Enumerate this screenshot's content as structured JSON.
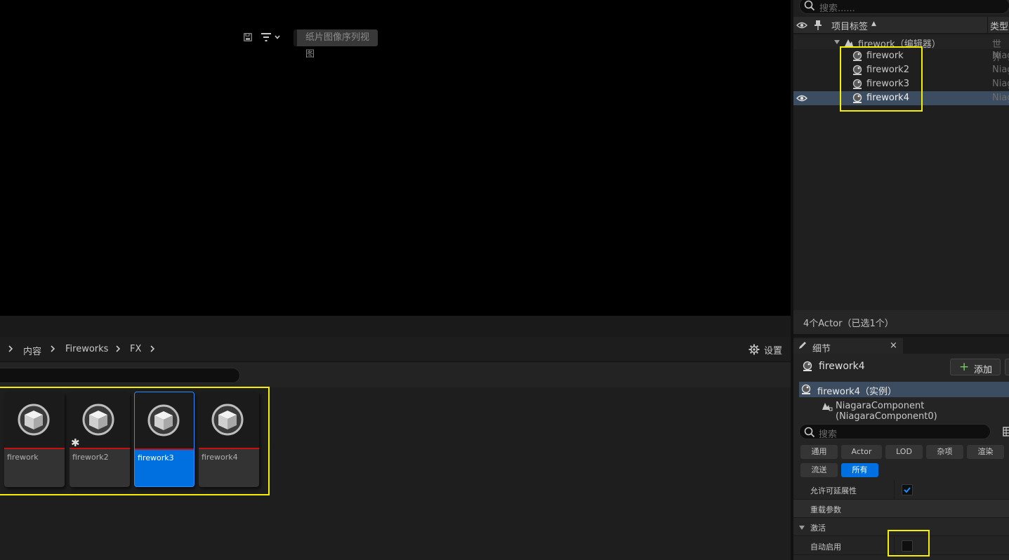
{
  "content_browser": {
    "breadcrumbs": [
      "内容",
      "Fireworks",
      "FX"
    ],
    "settings_label": "设置",
    "sprite_view_label": "纸片图像序列视图",
    "assets": [
      {
        "name": "firework",
        "dirty": false,
        "selected": false
      },
      {
        "name": "firework2",
        "dirty": true,
        "selected": false
      },
      {
        "name": "firework3",
        "dirty": false,
        "selected": true
      },
      {
        "name": "firework4",
        "dirty": false,
        "selected": false
      }
    ]
  },
  "outliner": {
    "search_placeholder": "搜索......",
    "column_label": "项目标签",
    "column_sort": "▲",
    "column_type": "类型",
    "world_label": "firework（编辑器）",
    "world_type": "世界",
    "items": [
      {
        "label": "firework",
        "type": "Niag"
      },
      {
        "label": "firework2",
        "type": "Niag"
      },
      {
        "label": "firework3",
        "type": "Niag"
      },
      {
        "label": "firework4",
        "type": "Niag",
        "selected": true
      }
    ],
    "footer": "4个Actor（已选1个）"
  },
  "details": {
    "tab_title": "细节",
    "tab_close": "×",
    "actor_name": "firework4",
    "add_label": "添加",
    "components": [
      {
        "label": "firework4（实例）",
        "selected": true
      },
      {
        "label": "NiagaraComponent (NiagaraComponent0)",
        "selected": false
      }
    ],
    "search_placeholder": "搜索",
    "filter_chips": [
      "通用",
      "Actor",
      "LOD",
      "杂项",
      "渲染",
      "流送",
      "所有"
    ],
    "active_chip": "所有",
    "properties": [
      {
        "label": "允许可延展性",
        "checked": true
      },
      {
        "label": "重载参数",
        "category": false
      },
      {
        "label": "激活",
        "category": true
      },
      {
        "label": "自动启用",
        "checked": false
      }
    ]
  },
  "colors": {
    "highlight": "#f5f000",
    "selection_blue": "#0070e0",
    "row_selected": "#3d4d61",
    "asset_underline": "#c41010"
  }
}
